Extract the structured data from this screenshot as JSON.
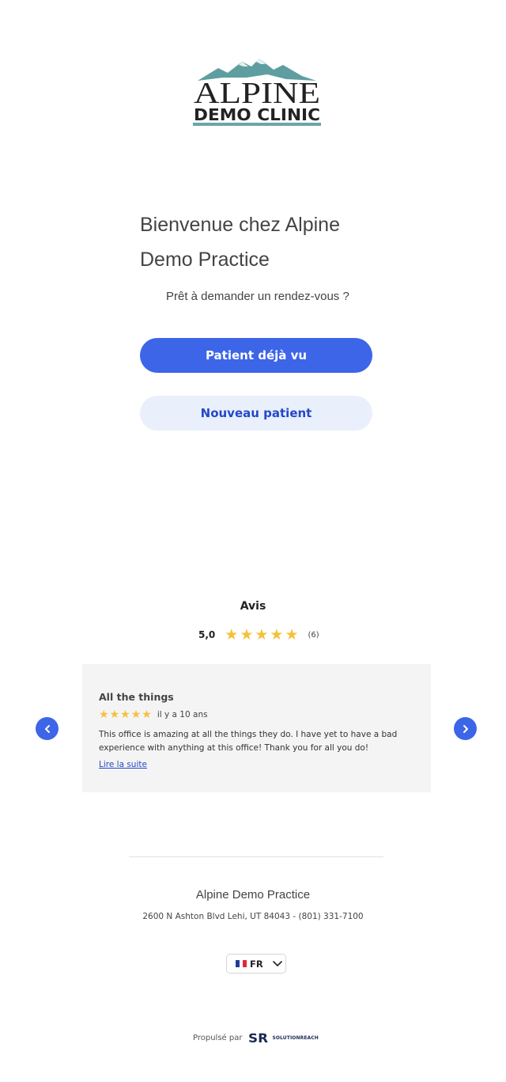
{
  "logo": {
    "line1": "ALPINE",
    "line2": "DEMO CLINIC",
    "mountain_color": "#5f9ea0",
    "text_color": "#222222",
    "bar_color": "#6aa6a8"
  },
  "welcome": {
    "title_line1": "Bienvenue chez Alpine",
    "title_line2": "Demo Practice",
    "subtitle": "Prêt à demander un rendez-vous ?"
  },
  "buttons": {
    "existing_patient": "Patient déjà vu",
    "new_patient": "Nouveau patient"
  },
  "reviews": {
    "title": "Avis",
    "average": "5,0",
    "average_stars": 5,
    "count": "(6)",
    "star_color": "#f5c13a",
    "items": [
      {
        "title": "All the things",
        "stars": 5,
        "age": "il y a 10 ans",
        "text": "This office is amazing at all the things they do. I have yet to have a bad experience with anything at this office! Thank you for all you do!",
        "read_more": "Lire la suite"
      }
    ]
  },
  "footer": {
    "practice_name": "Alpine Demo Practice",
    "address": "2600 N Ashton Blvd Lehi, UT 84043 - (801) 331-7100",
    "language": {
      "selected": "FR",
      "flag_colors": [
        "#1f3b9b",
        "#ffffff",
        "#e0293a"
      ]
    },
    "powered_by": "Propulsé par",
    "brand_mark": "SR",
    "brand_name": "SOLUTIONREACH"
  },
  "colors": {
    "primary": "#3d65e8",
    "secondary_bg": "#e9effb",
    "secondary_text": "#2348c8",
    "card_bg": "#f4f4f4"
  }
}
